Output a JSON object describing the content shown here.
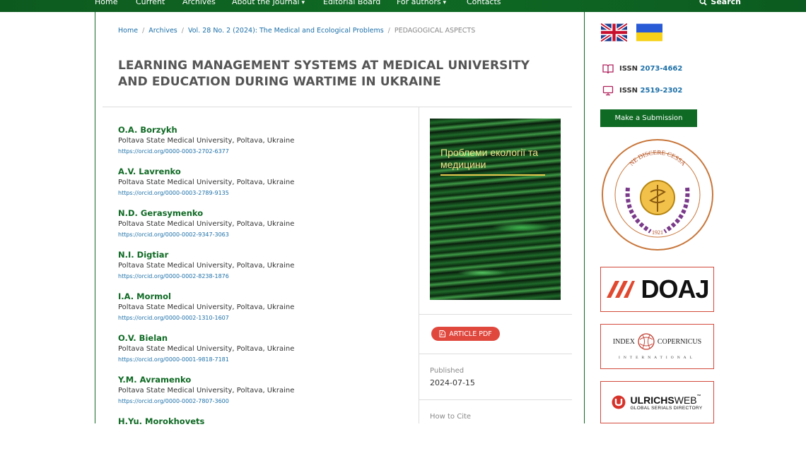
{
  "nav": {
    "items": [
      {
        "label": "Home",
        "caret": false
      },
      {
        "label": "Current",
        "caret": false
      },
      {
        "label": "Archives",
        "caret": false
      },
      {
        "label": "About the Journal",
        "caret": true
      },
      {
        "label": "Editorial Board",
        "caret": false
      },
      {
        "label": "For authors",
        "caret": true
      },
      {
        "label": "Contacts",
        "caret": false
      }
    ],
    "search_label": "Search"
  },
  "breadcrumb": {
    "home": "Home",
    "archives": "Archives",
    "issue": "Vol. 28 No. 2 (2024): The Medical and Ecological Problems",
    "section": "PEDAGOGICAL ASPECTS"
  },
  "article": {
    "title": "LEARNING MANAGEMENT SYSTEMS AT MEDICAL UNIVERSITY AND EDUCATION DURING WARTIME IN UKRAINE",
    "authors": [
      {
        "name": "O.A. Borzykh",
        "affiliation": "Poltava State Medical University, Poltava, Ukraine",
        "orcid": "https://orcid.org/0000-0003-2702-6377"
      },
      {
        "name": "A.V. Lavrenko",
        "affiliation": "Poltava State Medical University, Poltava, Ukraine",
        "orcid": "https://orcid.org/0000-0003-2789-9135"
      },
      {
        "name": "N.D. Gerasymenko",
        "affiliation": "Poltava State Medical University, Poltava, Ukraine",
        "orcid": "https://orcid.org/0000-0002-9347-3063"
      },
      {
        "name": "N.I. Digtiar",
        "affiliation": "Poltava State Medical University, Poltava, Ukraine",
        "orcid": "https://orcid.org/0000-0002-8238-1876"
      },
      {
        "name": "I.A. Mormol",
        "affiliation": "Poltava State Medical University, Poltava, Ukraine",
        "orcid": "https://orcid.org/0000-0002-1310-1607"
      },
      {
        "name": "O.V. Bielan",
        "affiliation": "Poltava State Medical University, Poltava, Ukraine",
        "orcid": "https://orcid.org/0000-0001-9818-7181"
      },
      {
        "name": "Y.M. Avramenko",
        "affiliation": "Poltava State Medical University, Poltava, Ukraine",
        "orcid": "https://orcid.org/0000-0002-7807-3600"
      },
      {
        "name": "H.Yu. Morokhovets",
        "affiliation": "",
        "orcid": ""
      }
    ],
    "cover_title": "Проблеми екології та медицини",
    "pdf_label": "ARTICLE PDF",
    "published_label": "Published",
    "published_date": "2024-07-15",
    "cite_label": "How to Cite"
  },
  "sidebar": {
    "issn_print_label": "ISSN",
    "issn_print": "2073-4662",
    "issn_online_label": "ISSN",
    "issn_online": "2519-2302",
    "submit_label": "Make a Submission",
    "seal_top": "NE DISCERE CESSA",
    "seal_year": "1921",
    "doaj_label": "DOAJ",
    "copernicus_left": "INDEX",
    "copernicus_right": "COPERNICUS",
    "copernicus_sub": "INTERNATIONAL",
    "ulrich_main": "ULRICHS",
    "ulrich_suffix": "WEB",
    "ulrich_sub": "GLOBAL SERIALS DIRECTORY"
  },
  "colors": {
    "brand_green": "#0f6a24",
    "link_blue": "#1b6fa8",
    "pdf_red": "#e0483e",
    "badge_border": "#d24a3c"
  }
}
